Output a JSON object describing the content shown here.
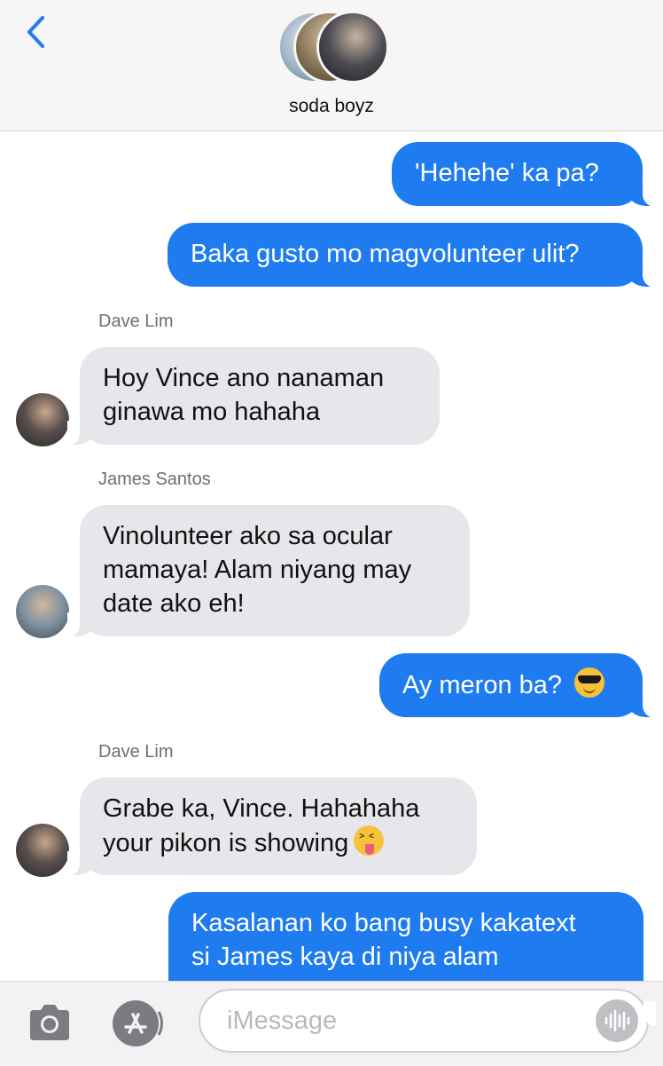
{
  "header": {
    "group_name": "soda boyz"
  },
  "messages": [
    {
      "type": "sent",
      "text": "'Hehehe' ka pa?"
    },
    {
      "type": "sent",
      "text": "Baka gusto mo magvolunteer ulit?"
    },
    {
      "type": "recv",
      "sender": "Dave Lim",
      "lines": [
        "Hoy Vince ano nanaman",
        "ginawa mo hahaha"
      ]
    },
    {
      "type": "recv",
      "sender": "James Santos",
      "lines": [
        "Vinolunteer ako sa ocular",
        "mamaya! Alam niyang may",
        "date ako eh!"
      ]
    },
    {
      "type": "sent",
      "text": "Ay meron ba?",
      "emoji": "smiling-face-with-sunglasses"
    },
    {
      "type": "recv",
      "sender": "Dave Lim",
      "lines": [
        "Grabe ka, Vince. Hahahaha",
        "your pikon is showing"
      ],
      "emoji": "squinting-face-with-tongue"
    },
    {
      "type": "sent",
      "lines": [
        "Kasalanan ko bang busy kakatext",
        "si James kaya di niya alam"
      ]
    }
  ],
  "composer": {
    "placeholder": "iMessage"
  },
  "colors": {
    "sent_bubble": "#1e7cf0",
    "received_bubble": "#e6e6eb",
    "back_chevron": "#1e7cf0"
  }
}
